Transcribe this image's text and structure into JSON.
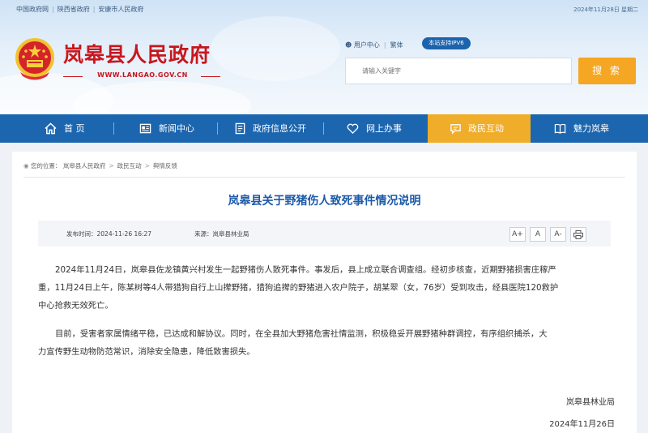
{
  "topbar": {
    "links": [
      "中国政府网",
      "陕西省政府",
      "安康市人民政府"
    ],
    "date": "2024年11月28日 星期二"
  },
  "header": {
    "site_title": "岚皋县人民政府",
    "site_url": "WWW.LANGAO.GOV.CN",
    "user_center": "用户中心",
    "accessibility": "繁体",
    "ipv6_badge": "本站支持IPV6",
    "search_placeholder": "请输入关键字",
    "search_button": "搜 索"
  },
  "nav": {
    "items": [
      {
        "label": "首 页",
        "icon": "home-icon"
      },
      {
        "label": "新闻中心",
        "icon": "newspaper-icon"
      },
      {
        "label": "政府信息公开",
        "icon": "document-icon"
      },
      {
        "label": "网上办事",
        "icon": "heart-hand-icon"
      },
      {
        "label": "政民互动",
        "icon": "chat-icon",
        "active": true
      },
      {
        "label": "魅力岚皋",
        "icon": "book-icon"
      }
    ]
  },
  "breadcrumb": {
    "label": "您的位置：",
    "items": [
      "岚皋县人民政府",
      "政民互动",
      "舆情反馈"
    ]
  },
  "article": {
    "title": "岚皋县关于野猪伤人致死事件情况说明",
    "publish_time": "发布时间：2024-11-26 16:27",
    "source": "来源：岚皋县林业局",
    "font_buttons": [
      "A+",
      "A",
      "A-"
    ],
    "paragraph_1_line_1": "2024年11月24日，岚皋县佐龙镇黄兴村发生一起野猪伤人致死事件。事发后，县上成立联合调查组。经初步核查，近期野猪损害庄稼严",
    "paragraph_1_line_2": "重，11月24日上午，陈某树等4人带猎狗自行上山撵野猪，猎狗追撵的野猪进入农户院子，胡某翠（女，76岁）受到攻击，经县医院120救护",
    "paragraph_1_line_3": "中心抢救无效死亡。",
    "paragraph_2_line_1": "目前，受害者家属情绪平稳，已达成和解协议。同时，在全县加大野猪危害社情监测，积极稳妥开展野猪种群调控，有序组织捕杀，大",
    "paragraph_2_line_2": "力宣传野生动物防范常识，消除安全隐患，降低致害损失。",
    "signature": "岚皋县林业局",
    "sign_date": "2024年11月26日"
  },
  "colors": {
    "brand_red": "#c8161d",
    "nav_blue": "#1c66b0",
    "active_orange": "#f0ad2a",
    "title_blue": "#1c5aa8",
    "search_orange": "#f5a623"
  }
}
